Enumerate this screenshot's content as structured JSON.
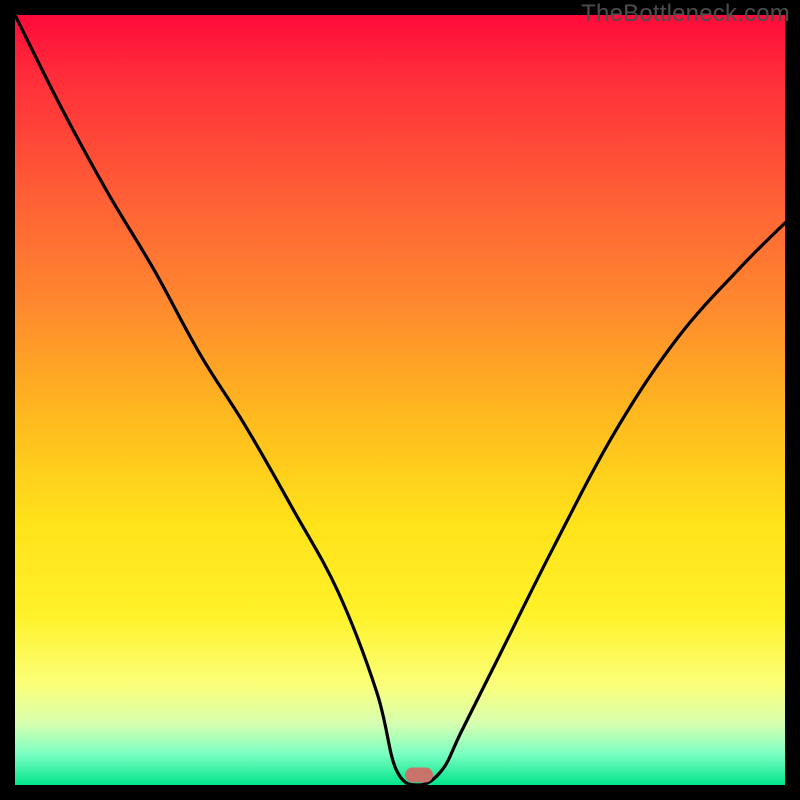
{
  "watermark": "TheBottleneck.com",
  "marker": {
    "x_frac": 0.525,
    "y_frac": 0.987
  },
  "chart_data": {
    "type": "line",
    "title": "",
    "xlabel": "",
    "ylabel": "",
    "xlim": [
      0,
      100
    ],
    "ylim": [
      0,
      100
    ],
    "series": [
      {
        "name": "bottleneck-curve",
        "x": [
          0,
          6,
          12,
          18,
          24,
          30,
          36,
          42,
          47,
          49.5,
          52.5,
          55.5,
          58,
          63,
          70,
          78,
          86,
          94,
          100
        ],
        "y": [
          100,
          88,
          77,
          67,
          56,
          46.5,
          36,
          25,
          12,
          2,
          0,
          2,
          7,
          17,
          31,
          46,
          58,
          67,
          73
        ]
      }
    ],
    "marker_point": {
      "x": 52.5,
      "y": 0
    }
  }
}
